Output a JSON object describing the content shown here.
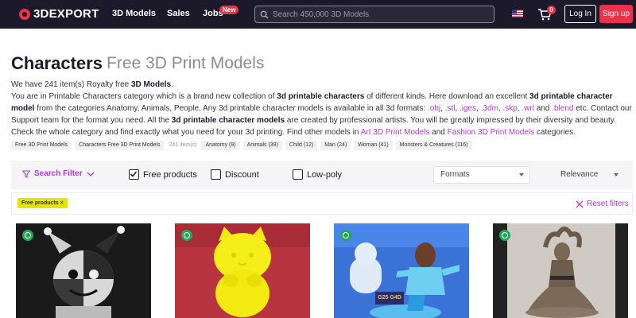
{
  "header": {
    "logo": "3DEXPORT",
    "nav": [
      "3D Models",
      "Sales",
      "Jobs"
    ],
    "new_badge": "New",
    "search_placeholder": "Search 450,000 3D Models",
    "cart_count": "0",
    "login": "Log In",
    "signup": "Sign up"
  },
  "page": {
    "title": "Characters",
    "subtitle": "Free 3D Print Models",
    "count_text_1": "We have 241 item(s) Royalty free ",
    "count_bold": "3D Models",
    "count_text_2": ".",
    "intro_1": "You are in Printable Characters category which is a brand new collection of ",
    "intro_b1": "3d printable characters",
    "intro_2": " of different kinds. Here download an excellent ",
    "intro_b2": "3d printable character model",
    "intro_3": " from the categories Anatomy, Animals, People. Any 3d printable character models is available in all 3d formats: ",
    "formats": [
      ".obj",
      ".stl",
      ".iges",
      ".3dm",
      ".skp",
      ".wrl"
    ],
    "and": "and",
    "format_last": ".blend",
    "intro_4": " etc. Contact our Support team for the format you need. All the ",
    "intro_b3": "3d printable character models",
    "intro_5": " are created by professional artists. You will be greatly impressed by their diversity and beauty. Check the whole category and find exactly what you need for your 3d printing. Find other models in ",
    "link_art": "Art 3D Print Models",
    "and2": " and ",
    "link_fashion": "Fashion 3D Print Models",
    "intro_6": " categories."
  },
  "breadcrumbs": [
    "Free 3D Print Models",
    "Characters Free 3D Print Models",
    "241 item(s)",
    "Anatomy (9)",
    "Animals (39)",
    "Child (12)",
    "Man (24)",
    "Woman (41)",
    "Monsters & Creatures (116)"
  ],
  "filters": {
    "search_filter": "Search Filter",
    "free_products": "Free products",
    "free_checked": true,
    "discount": "Discount",
    "lowpoly": "Low-poly",
    "formats": "Formats",
    "relevance": "Relevance",
    "active_tag": "Free products ×",
    "reset": "Reset filters"
  },
  "cards": [
    {
      "icon": "printable-icon",
      "label_on_image": ""
    },
    {
      "icon": "printable-icon",
      "label_on_image": ""
    },
    {
      "icon": "printable-icon",
      "label_on_image": "G25 G4D"
    },
    {
      "icon": "printable-icon",
      "label_on_image": ""
    }
  ],
  "colors": {
    "accent": "#e8334a",
    "link": "#b13bd1",
    "header_bg": "#1c1a2a",
    "tag": "#e2e600"
  }
}
